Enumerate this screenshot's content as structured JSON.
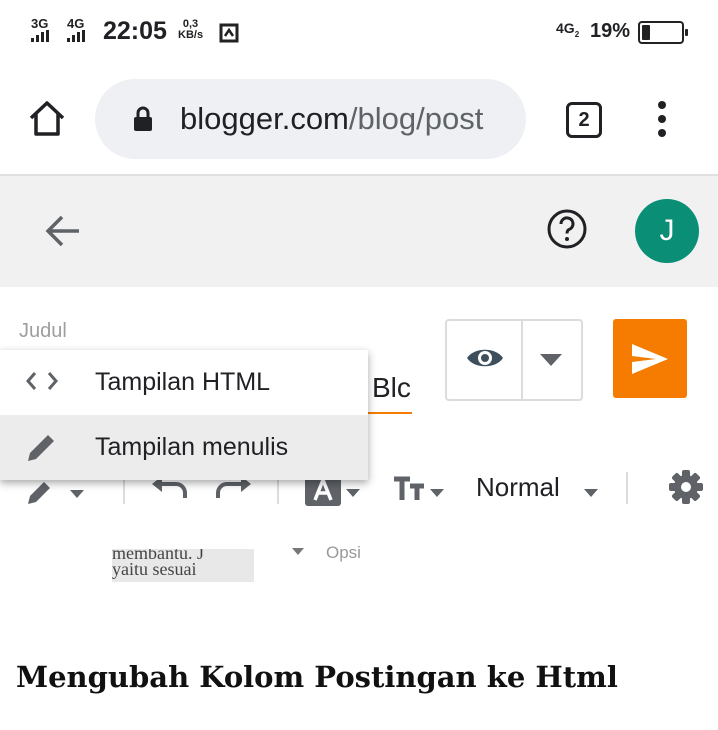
{
  "status_bar": {
    "net1": "3G",
    "net2": "4G",
    "time": "22:05",
    "speed_value": "0,3",
    "speed_unit": "KB/s",
    "lte": "4G",
    "lte_sub": "2",
    "battery_pct": "19%",
    "battery_level": 0.19
  },
  "browser": {
    "url_domain": "blogger.com",
    "url_path": "/blog/post",
    "tab_count": "2"
  },
  "header": {
    "avatar_initial": "J"
  },
  "editor": {
    "title_label": "Judul",
    "title_fragment": "Blc"
  },
  "menu": {
    "items": [
      {
        "label": "Tampilan HTML",
        "icon": "code-icon",
        "selected": false
      },
      {
        "label": "Tampilan menulis",
        "icon": "pencil-icon",
        "selected": true
      }
    ]
  },
  "toolbar": {
    "paragraph_style": "Normal"
  },
  "content": {
    "image_text_1": "membantu. J",
    "image_text_2": "yaitu sesuai",
    "opsi": "Opsi",
    "heading": "Mengubah Kolom Postingan ke Html"
  },
  "colors": {
    "accent": "#f57c00",
    "avatar": "#0a8f76",
    "preview_icon": "#3d4f5c"
  }
}
